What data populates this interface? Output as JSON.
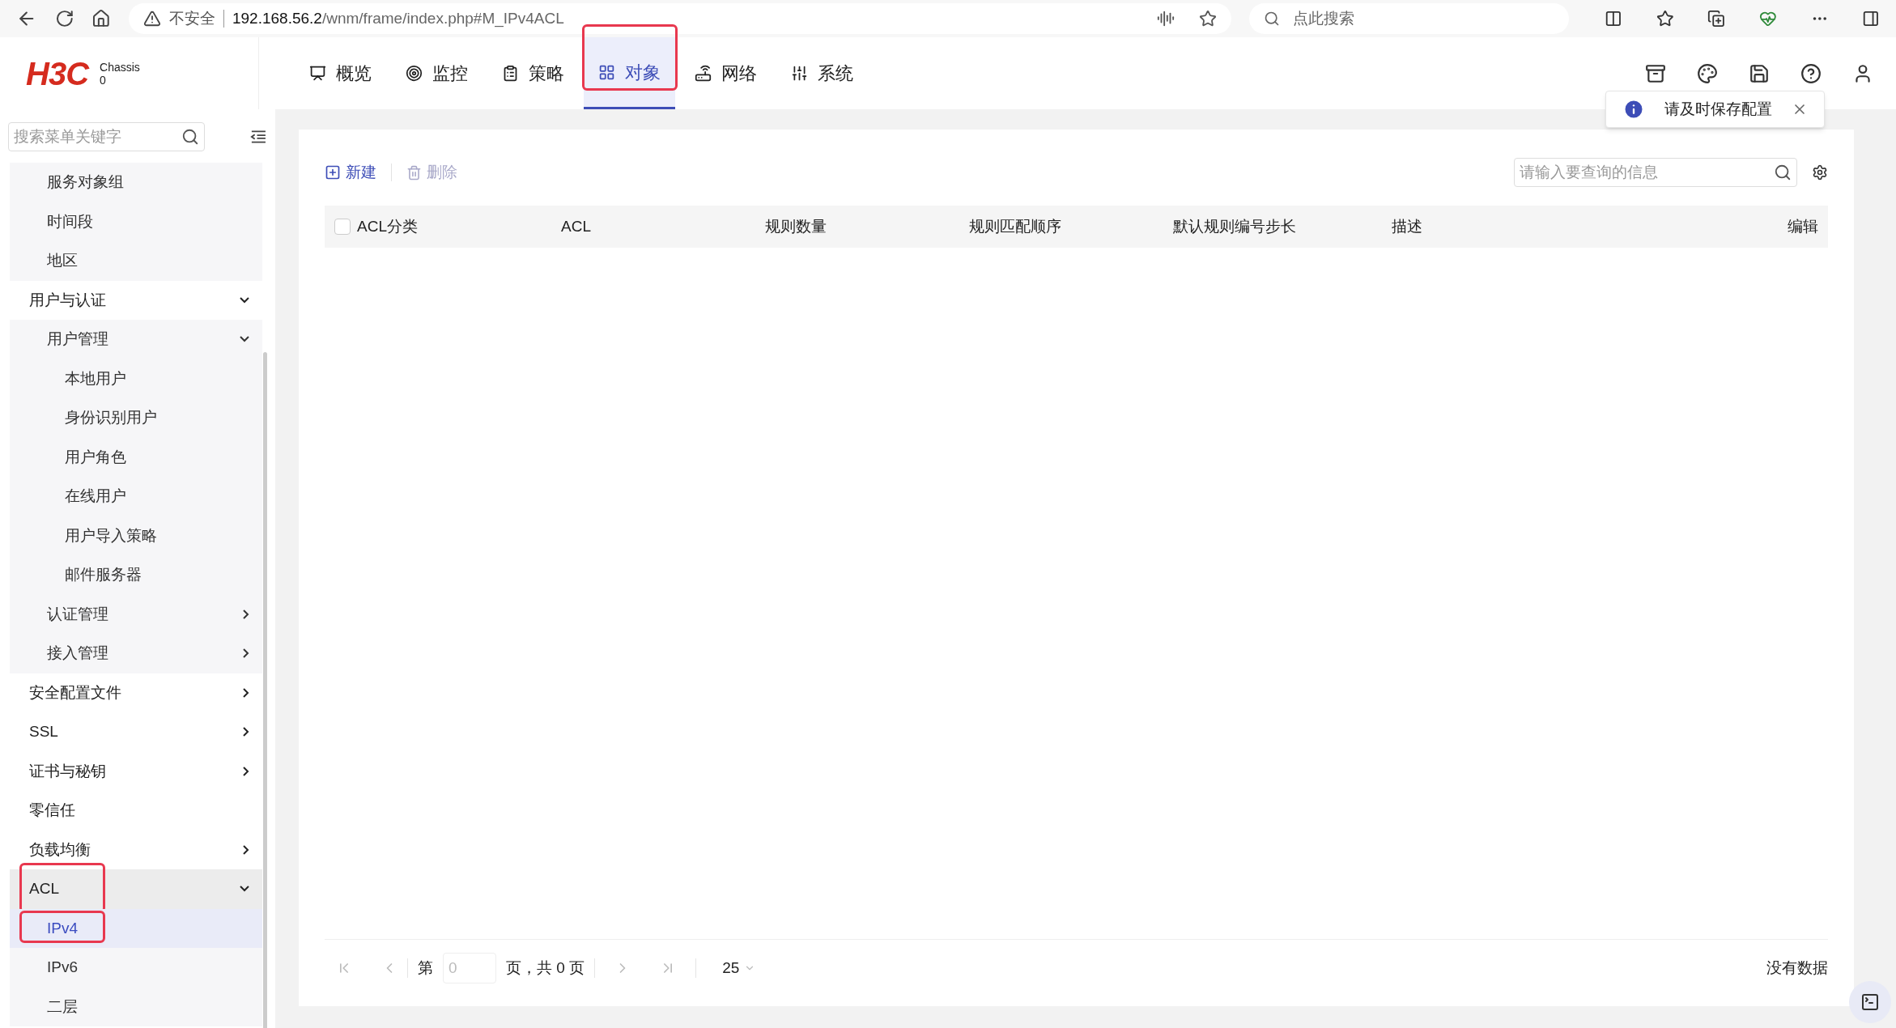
{
  "browser": {
    "security": "不安全",
    "url_host": "192.168.56.2",
    "url_path": "/wnm/frame/index.php#M_IPv4ACL",
    "search_placeholder": "点此搜索"
  },
  "header": {
    "logo": "H3C",
    "device": "Chassis",
    "device_id": "0",
    "tabs": [
      {
        "label": "概览",
        "selected": false,
        "annotated": false
      },
      {
        "label": "监控",
        "selected": false,
        "annotated": false
      },
      {
        "label": "策略",
        "selected": false,
        "annotated": false
      },
      {
        "label": "对象",
        "selected": true,
        "annotated": true
      },
      {
        "label": "网络",
        "selected": false,
        "annotated": false
      },
      {
        "label": "系统",
        "selected": false,
        "annotated": false
      }
    ],
    "toast": {
      "text": "请及时保存配置"
    }
  },
  "sidebar": {
    "search_placeholder": "搜索菜单关键字",
    "items": [
      {
        "kind": "hidden",
        "children": [
          {
            "kind": "leaf",
            "label": "服务对象组",
            "selected": false,
            "annotated": false
          },
          {
            "kind": "leaf",
            "label": "时间段",
            "selected": false,
            "annotated": false
          },
          {
            "kind": "leaf",
            "label": "地区",
            "selected": false,
            "annotated": false
          }
        ]
      },
      {
        "kind": "group",
        "label": "用户与认证",
        "expanded": true,
        "selected": false,
        "annotated": false,
        "children": [
          {
            "kind": "group",
            "label": "用户管理",
            "expanded": true,
            "selected": false,
            "annotated": false,
            "children": [
              {
                "kind": "leaf",
                "label": "本地用户",
                "selected": false,
                "annotated": false
              },
              {
                "kind": "leaf",
                "label": "身份识别用户",
                "selected": false,
                "annotated": false
              },
              {
                "kind": "leaf",
                "label": "用户角色",
                "selected": false,
                "annotated": false
              },
              {
                "kind": "leaf",
                "label": "在线用户",
                "selected": false,
                "annotated": false
              },
              {
                "kind": "leaf",
                "label": "用户导入策略",
                "selected": false,
                "annotated": false
              },
              {
                "kind": "leaf",
                "label": "邮件服务器",
                "selected": false,
                "annotated": false
              }
            ]
          },
          {
            "kind": "group",
            "label": "认证管理",
            "expanded": false,
            "selected": false,
            "annotated": false
          },
          {
            "kind": "group",
            "label": "接入管理",
            "expanded": false,
            "selected": false,
            "annotated": false
          }
        ]
      },
      {
        "kind": "group",
        "label": "安全配置文件",
        "expanded": false,
        "selected": false,
        "annotated": false
      },
      {
        "kind": "group",
        "label": "SSL",
        "expanded": false,
        "selected": false,
        "annotated": false
      },
      {
        "kind": "group",
        "label": "证书与秘钥",
        "expanded": false,
        "selected": false,
        "annotated": false
      },
      {
        "kind": "leaf",
        "label": "零信任",
        "selected": false,
        "annotated": false
      },
      {
        "kind": "group",
        "label": "负载均衡",
        "expanded": false,
        "selected": false,
        "annotated": false
      },
      {
        "kind": "group",
        "label": "ACL",
        "expanded": true,
        "selected": true,
        "annotated": true,
        "children": [
          {
            "kind": "leaf",
            "label": "IPv4",
            "selected": true,
            "annotated": true
          },
          {
            "kind": "leaf",
            "label": "IPv6",
            "selected": false,
            "annotated": false
          },
          {
            "kind": "leaf",
            "label": "二层",
            "selected": false,
            "annotated": false
          }
        ]
      }
    ]
  },
  "toolbar": {
    "new_label": "新建",
    "delete_label": "删除",
    "delete_disabled": true,
    "search_placeholder": "请输入要查询的信息"
  },
  "table": {
    "select_all_checked": false,
    "columns": [
      "ACL分类",
      "ACL",
      "规则数量",
      "规则匹配顺序",
      "默认规则编号步长",
      "描述",
      "编辑"
    ]
  },
  "pagination": {
    "page_prefix": "第",
    "page_value": "0",
    "page_suffix": "页，共 0 页",
    "page_size": "25",
    "empty_text": "没有数据"
  }
}
